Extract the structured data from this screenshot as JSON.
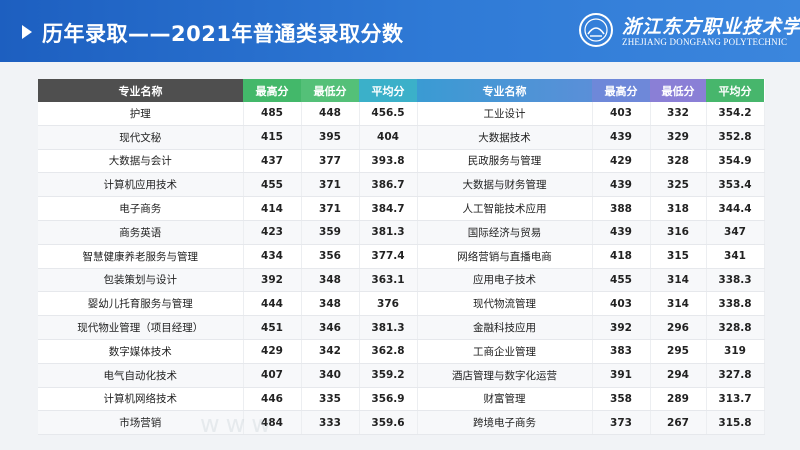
{
  "header": {
    "title": "历年录取——2021年普通类录取分数",
    "logo_cn": "浙江东方职业技术学院",
    "logo_en": "ZHEJIANG DONGFANG POLYTECHNIC"
  },
  "table": {
    "columns": [
      "专业名称",
      "最高分",
      "最低分",
      "平均分",
      "专业名称",
      "最高分",
      "最低分",
      "平均分"
    ],
    "rows": [
      [
        "护理",
        "485",
        "448",
        "456.5",
        "工业设计",
        "403",
        "332",
        "354.2"
      ],
      [
        "现代文秘",
        "415",
        "395",
        "404",
        "大数据技术",
        "439",
        "329",
        "352.8"
      ],
      [
        "大数据与会计",
        "437",
        "377",
        "393.8",
        "民政服务与管理",
        "429",
        "328",
        "354.9"
      ],
      [
        "计算机应用技术",
        "455",
        "371",
        "386.7",
        "大数据与财务管理",
        "439",
        "325",
        "353.4"
      ],
      [
        "电子商务",
        "414",
        "371",
        "384.7",
        "人工智能技术应用",
        "388",
        "318",
        "344.4"
      ],
      [
        "商务英语",
        "423",
        "359",
        "381.3",
        "国际经济与贸易",
        "439",
        "316",
        "347"
      ],
      [
        "智慧健康养老服务与管理",
        "434",
        "356",
        "377.4",
        "网络营销与直播电商",
        "418",
        "315",
        "341"
      ],
      [
        "包装策划与设计",
        "392",
        "348",
        "363.1",
        "应用电子技术",
        "455",
        "314",
        "338.3"
      ],
      [
        "婴幼儿托育服务与管理",
        "444",
        "348",
        "376",
        "现代物流管理",
        "403",
        "314",
        "338.8"
      ],
      [
        "现代物业管理（项目经理）",
        "451",
        "346",
        "381.3",
        "金融科技应用",
        "392",
        "296",
        "328.8"
      ],
      [
        "数字媒体技术",
        "429",
        "342",
        "362.8",
        "工商企业管理",
        "383",
        "295",
        "319"
      ],
      [
        "电气自动化技术",
        "407",
        "340",
        "359.2",
        "酒店管理与数字化运营",
        "391",
        "294",
        "327.8"
      ],
      [
        "计算机网络技术",
        "446",
        "335",
        "356.9",
        "财富管理",
        "358",
        "289",
        "313.7"
      ],
      [
        "市场营销",
        "484",
        "333",
        "359.6",
        "跨境电子商务",
        "373",
        "267",
        "315.8"
      ]
    ]
  },
  "colors": {
    "banner": "#2f7ad6",
    "header_dark": "#4f4f4f",
    "header_green": "#43b86a",
    "header_teal": "#3bb0c9",
    "header_purple": "#8a7fd6"
  }
}
